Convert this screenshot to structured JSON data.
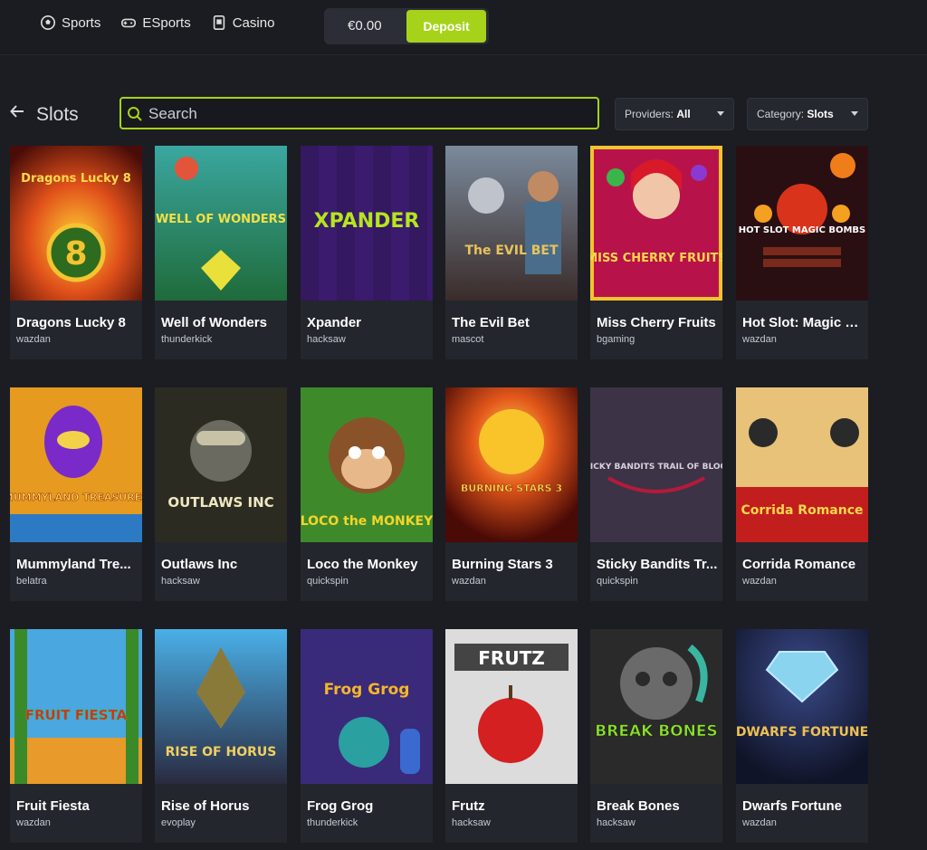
{
  "nav": {
    "links": [
      {
        "label": "Sports",
        "icon": "soccer-ball-icon"
      },
      {
        "label": "ESports",
        "icon": "gamepad-icon"
      },
      {
        "label": "Casino",
        "icon": "card-icon"
      }
    ]
  },
  "wallet": {
    "balance": "€0.00",
    "deposit_label": "Deposit"
  },
  "header": {
    "title": "Slots",
    "back_icon": "arrow-left-icon"
  },
  "search": {
    "placeholder": "Search"
  },
  "filters": {
    "providers_label": "Providers:",
    "providers_value": "All",
    "category_label": "Category:",
    "category_value": "Slots"
  },
  "colors": {
    "accent": "#a6d31a",
    "background": "#1b1d23",
    "card": "#23262d"
  },
  "games": [
    {
      "title": "Dragons Lucky 8",
      "provider": "wazdan",
      "art": "Dragons Lucky 8"
    },
    {
      "title": "Well of Wonders",
      "provider": "thunderkick",
      "art": "WELL OF WONDERS"
    },
    {
      "title": "Xpander",
      "provider": "hacksaw",
      "art": "XPANDER"
    },
    {
      "title": "The Evil Bet",
      "provider": "mascot",
      "art": "The EVIL BET"
    },
    {
      "title": "Miss Cherry Fruits",
      "provider": "bgaming",
      "art": "MISS CHERRY FRUITS"
    },
    {
      "title": "Hot Slot: Magic B...",
      "provider": "wazdan",
      "art": "HOT SLOT MAGIC BOMBS"
    },
    {
      "title": "Mummyland Tre...",
      "provider": "belatra",
      "art": "MUMMYLAND TREASURES"
    },
    {
      "title": "Outlaws Inc",
      "provider": "hacksaw",
      "art": "OUTLAWS INC"
    },
    {
      "title": "Loco the Monkey",
      "provider": "quickspin",
      "art": "LOCO the MONKEY"
    },
    {
      "title": "Burning Stars 3",
      "provider": "wazdan",
      "art": "BURNING STARS 3"
    },
    {
      "title": "Sticky Bandits Tr...",
      "provider": "quickspin",
      "art": "STICKY BANDITS TRAIL OF BLOOD"
    },
    {
      "title": "Corrida Romance",
      "provider": "wazdan",
      "art": "Corrida Romance"
    },
    {
      "title": "Fruit Fiesta",
      "provider": "wazdan",
      "art": "FRUIT FIESTA"
    },
    {
      "title": "Rise of Horus",
      "provider": "evoplay",
      "art": "RISE OF HORUS"
    },
    {
      "title": "Frog Grog",
      "provider": "thunderkick",
      "art": "Frog Grog"
    },
    {
      "title": "Frutz",
      "provider": "hacksaw",
      "art": "FRUTZ"
    },
    {
      "title": "Break Bones",
      "provider": "hacksaw",
      "art": "BREAK BONES"
    },
    {
      "title": "Dwarfs Fortune",
      "provider": "wazdan",
      "art": "DWARFS FORTUNE"
    }
  ]
}
